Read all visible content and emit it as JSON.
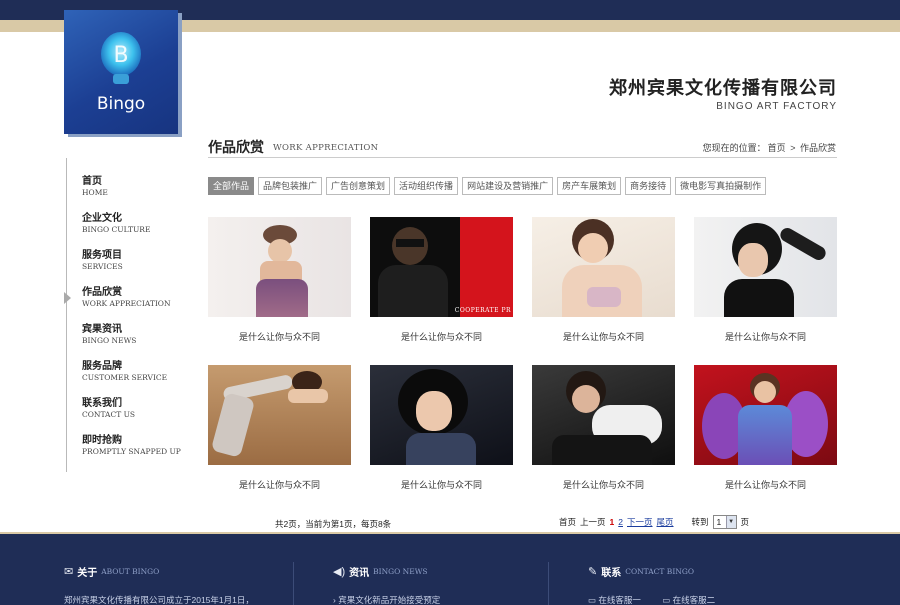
{
  "brand": {
    "logo_text": "Bingo",
    "company_cn": "郑州宾果文化传播有限公司",
    "company_en": "BINGO ART FACTORY"
  },
  "nav": [
    {
      "cn": "首页",
      "en": "HOME"
    },
    {
      "cn": "企业文化",
      "en": "BINGO CULTURE"
    },
    {
      "cn": "服务项目",
      "en": "SERVICES"
    },
    {
      "cn": "作品欣赏",
      "en": "WORK APPRECIATION"
    },
    {
      "cn": "宾果资讯",
      "en": "BINGO NEWS"
    },
    {
      "cn": "服务品牌",
      "en": "CUSTOMER SERVICE"
    },
    {
      "cn": "联系我们",
      "en": "CONTACT US"
    },
    {
      "cn": "即时抢购",
      "en": "PROMPTLY SNAPPED UP"
    }
  ],
  "section": {
    "title": "作品欣赏",
    "subtitle": "WORK APPRECIATION",
    "breadcrumb_prefix": "您现在的位置：",
    "breadcrumb_home": "首页",
    "breadcrumb_sep": ">",
    "breadcrumb_current": "作品欣赏"
  },
  "filters": [
    "全部作品",
    "品牌包装推广",
    "广告创意策划",
    "活动组织传播",
    "网站建设及营销推广",
    "房产车展策划",
    "商务接待",
    "微电影写真拍摄制作"
  ],
  "gallery": {
    "captions": [
      "是什么让你与众不同",
      "是什么让你与众不同",
      "是什么让你与众不同",
      "是什么让你与众不同",
      "是什么让你与众不同",
      "是什么让你与众不同",
      "是什么让你与众不同",
      "是什么让你与众不同"
    ],
    "photo_tag": "COOPERATE PR"
  },
  "pagination": {
    "info": "共2页，当前为第1页，每页8条",
    "first": "首页",
    "prev": "上一页",
    "page1": "1",
    "page2": "2",
    "next": "下一页",
    "last": "尾页",
    "goto": "转到",
    "page_value": "1",
    "page_suffix": "页"
  },
  "footer": {
    "about_cn": "关于",
    "about_en": "ABOUT BINGO",
    "about_text": "郑州宾果文化传播有限公司成立于2015年1月1日，",
    "news_cn": "资讯",
    "news_en": "BINGO NEWS",
    "news_item": "宾果文化新品开始接受预定",
    "contact_cn": "联系",
    "contact_en": "CONTACT BINGO",
    "service1": "在线客服一",
    "service2": "在线客服二"
  },
  "colors": {
    "navy": "#1f2d56",
    "sand": "#d9c9a6",
    "logo_blue": "#1c3f93",
    "active_page": "#cc0000",
    "link": "#1a3c9e"
  }
}
